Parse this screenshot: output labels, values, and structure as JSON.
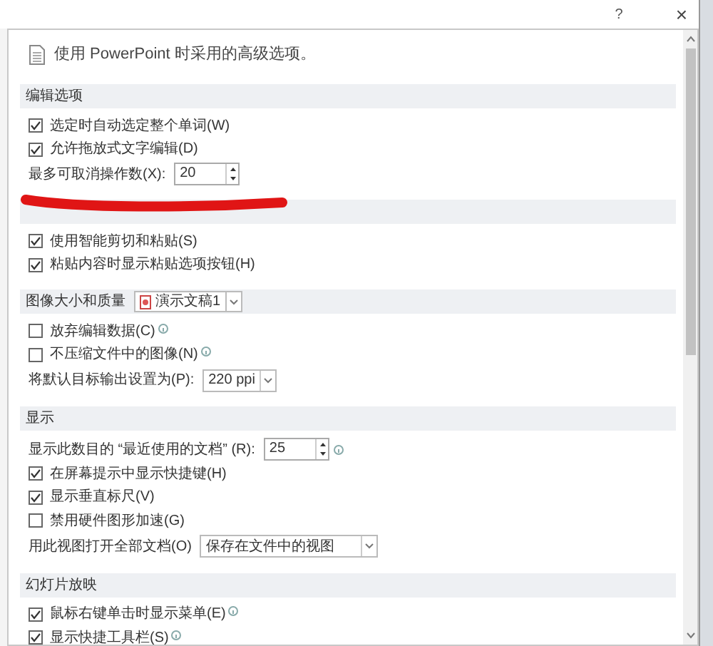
{
  "title_bar": {
    "help": "?",
    "close": "×"
  },
  "intro": "使用 PowerPoint 时采用的高级选项。",
  "sections": [
    {
      "title": "编辑选项",
      "items": [
        {
          "kind": "checkbox",
          "label": "选定时自动选定整个单词(W)",
          "checked": true
        },
        {
          "kind": "checkbox",
          "label": "允许拖放式文字编辑(D)",
          "checked": true
        },
        {
          "kind": "spinner",
          "label": "最多可取消操作数(X):",
          "value": "20"
        }
      ]
    },
    {
      "items": [
        {
          "kind": "checkbox",
          "label": "使用智能剪切和粘贴(S)",
          "checked": true
        },
        {
          "kind": "checkbox",
          "label": "粘贴内容时显示粘贴选项按钮(H)",
          "checked": true
        }
      ]
    },
    {
      "title": "图像大小和质量",
      "document": "演示文稿1",
      "items": [
        {
          "kind": "checkbox",
          "label": "放弃编辑数据(C)",
          "checked": false,
          "info": true
        },
        {
          "kind": "checkbox",
          "label": "不压缩文件中的图像(N)",
          "checked": false,
          "info": true
        },
        {
          "kind": "dropdown",
          "label": "将默认目标输出设置为(P):",
          "value": "220 ppi"
        }
      ]
    },
    {
      "title": "显示",
      "items": [
        {
          "kind": "spinner",
          "label": "显示此数目的 “最近使用的文档” (R):",
          "value": "25",
          "info": true
        },
        {
          "kind": "checkbox",
          "label": "在屏幕提示中显示快捷键(H)",
          "checked": true
        },
        {
          "kind": "checkbox",
          "label": "显示垂直标尺(V)",
          "checked": true
        },
        {
          "kind": "checkbox",
          "label": "禁用硬件图形加速(G)",
          "checked": false
        },
        {
          "kind": "dropdown",
          "label": "用此视图打开全部文档(O)",
          "value": "保存在文件中的视图",
          "wide": true
        }
      ]
    },
    {
      "title": "幻灯片放映",
      "items": [
        {
          "kind": "checkbox",
          "label": "鼠标右键单击时显示菜单(E)",
          "checked": true,
          "info": true
        },
        {
          "kind": "checkbox",
          "label": "显示快捷工具栏(S)",
          "checked": true,
          "info": true
        }
      ]
    }
  ]
}
